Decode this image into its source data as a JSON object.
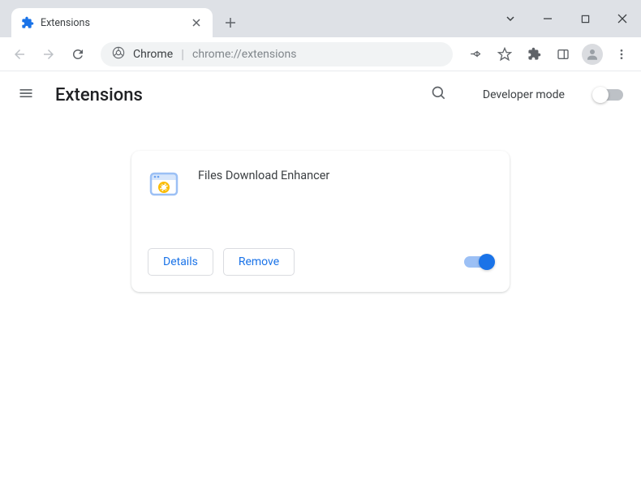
{
  "tab": {
    "title": "Extensions"
  },
  "addressbar": {
    "label": "Chrome",
    "url": "chrome://extensions"
  },
  "header": {
    "title": "Extensions",
    "developer_mode": "Developer mode"
  },
  "extension": {
    "name": "Files Download Enhancer",
    "details_label": "Details",
    "remove_label": "Remove",
    "enabled": true
  }
}
